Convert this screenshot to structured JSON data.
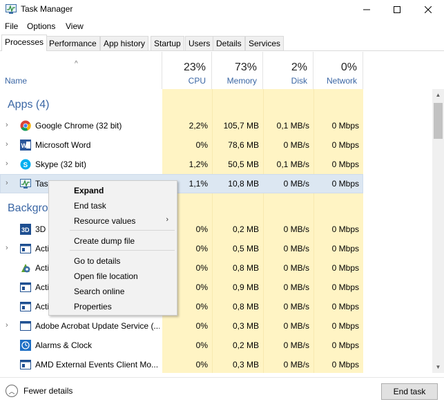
{
  "window": {
    "title": "Task Manager"
  },
  "menu": [
    "File",
    "Options",
    "View"
  ],
  "tabs": [
    "Processes",
    "Performance",
    "App history",
    "Startup",
    "Users",
    "Details",
    "Services"
  ],
  "columns": {
    "name": "Name",
    "cpu": {
      "label": "CPU",
      "pct": "23%"
    },
    "memory": {
      "label": "Memory",
      "pct": "73%"
    },
    "disk": {
      "label": "Disk",
      "pct": "2%"
    },
    "network": {
      "label": "Network",
      "pct": "0%"
    }
  },
  "sections": {
    "apps": "Apps (4)",
    "background": "Backgrou"
  },
  "apps": [
    {
      "name": "Google Chrome (32 bit)",
      "cpu": "2,2%",
      "mem": "105,7 MB",
      "disk": "0,1 MB/s",
      "net": "0 Mbps",
      "icon": "chrome-icon"
    },
    {
      "name": "Microsoft Word",
      "cpu": "0%",
      "mem": "78,6 MB",
      "disk": "0 MB/s",
      "net": "0 Mbps",
      "icon": "word-icon"
    },
    {
      "name": "Skype (32 bit)",
      "cpu": "1,2%",
      "mem": "50,5 MB",
      "disk": "0,1 MB/s",
      "net": "0 Mbps",
      "icon": "skype-icon"
    },
    {
      "name": "Task",
      "cpu": "1,1%",
      "mem": "10,8 MB",
      "disk": "0 MB/s",
      "net": "0 Mbps",
      "icon": "task-manager-icon"
    }
  ],
  "background": [
    {
      "name": "3D E",
      "cpu": "0%",
      "mem": "0,2 MB",
      "disk": "0 MB/s",
      "net": "0 Mbps",
      "icon": "3d-icon"
    },
    {
      "name": "Acti",
      "cpu": "0%",
      "mem": "0,5 MB",
      "disk": "0 MB/s",
      "net": "0 Mbps",
      "icon": "window-icon"
    },
    {
      "name": "Acti",
      "cpu": "0%",
      "mem": "0,8 MB",
      "disk": "0 MB/s",
      "net": "0 Mbps",
      "icon": "gear-icon"
    },
    {
      "name": "Acti",
      "cpu": "0%",
      "mem": "0,9 MB",
      "disk": "0 MB/s",
      "net": "0 Mbps",
      "icon": "window-icon"
    },
    {
      "name": "Acti",
      "cpu": "0%",
      "mem": "0,8 MB",
      "disk": "0 MB/s",
      "net": "0 Mbps",
      "icon": "window-icon"
    },
    {
      "name": "Adobe Acrobat Update Service (...",
      "cpu": "0%",
      "mem": "0,3 MB",
      "disk": "0 MB/s",
      "net": "0 Mbps",
      "icon": "window-icon"
    },
    {
      "name": "Alarms & Clock",
      "cpu": "0%",
      "mem": "0,2 MB",
      "disk": "0 MB/s",
      "net": "0 Mbps",
      "icon": "clock-icon"
    },
    {
      "name": "AMD External Events Client Mo...",
      "cpu": "0%",
      "mem": "0,3 MB",
      "disk": "0 MB/s",
      "net": "0 Mbps",
      "icon": "window-icon"
    }
  ],
  "context_menu": {
    "expand": "Expand",
    "end_task": "End task",
    "resource_values": "Resource values",
    "create_dump": "Create dump file",
    "go_to_details": "Go to details",
    "open_file_location": "Open file location",
    "search_online": "Search online",
    "properties": "Properties"
  },
  "footer": {
    "fewer_details": "Fewer details",
    "end_task": "End task"
  }
}
